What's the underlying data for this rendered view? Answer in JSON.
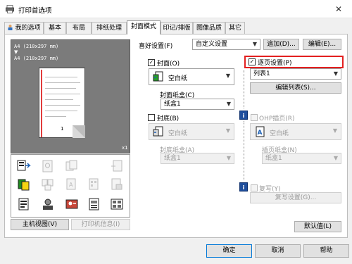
{
  "window": {
    "title": "打印首选项",
    "close_glyph": "✕"
  },
  "tabs": [
    {
      "label": "我的选项"
    },
    {
      "label": "基本"
    },
    {
      "label": "布局"
    },
    {
      "label": "排纸处理"
    },
    {
      "label": "封面模式"
    },
    {
      "label": "印记/排版"
    },
    {
      "label": "图像品质"
    },
    {
      "label": "其它"
    }
  ],
  "active_tab": "封面模式",
  "preview": {
    "line1": "A4 (210x297 mm)",
    "line2": "A4 (210x297 mm)",
    "page_number": "1",
    "scale": "x1"
  },
  "bottom_left_buttons": {
    "printer_view": "主机视图(V)",
    "printer_info": "打印机信息(I)"
  },
  "favorites": {
    "label": "喜好设置(F)",
    "value": "自定义设置",
    "add_button": "追加(D)...",
    "edit_button": "编辑(E)..."
  },
  "front_cover": {
    "checkbox_label": "封面(O)",
    "checked": true,
    "paper_type": "空白纸",
    "tray_label": "封面纸盒(C)",
    "tray_value": "纸盒1"
  },
  "back_cover": {
    "checkbox_label": "封底(B)",
    "checked": false,
    "paper_type": "空白纸",
    "tray_label": "封底纸盒(A)",
    "tray_value": "纸盒1"
  },
  "per_page": {
    "checkbox_label": "逐页设置(P)",
    "checked": true,
    "list_value": "列表1",
    "edit_list_button": "编辑列表(S)..."
  },
  "ohp": {
    "checkbox_label": "OHP插页(R)",
    "checked": false,
    "paper_type": "空白纸",
    "tray_label": "插页纸盒(N)",
    "tray_value": "纸盒1"
  },
  "carbon_copy": {
    "checkbox_label": "复写(Y)",
    "checked": false,
    "settings_button": "复写设置(G)..."
  },
  "default_button": "默认值(L)",
  "dialog_buttons": {
    "ok": "确定",
    "cancel": "取消",
    "help": "帮助"
  },
  "colors": {
    "highlight": "#e32020",
    "info_icon": "#1f4e9c",
    "preview_bg": "#7b7b7b"
  }
}
